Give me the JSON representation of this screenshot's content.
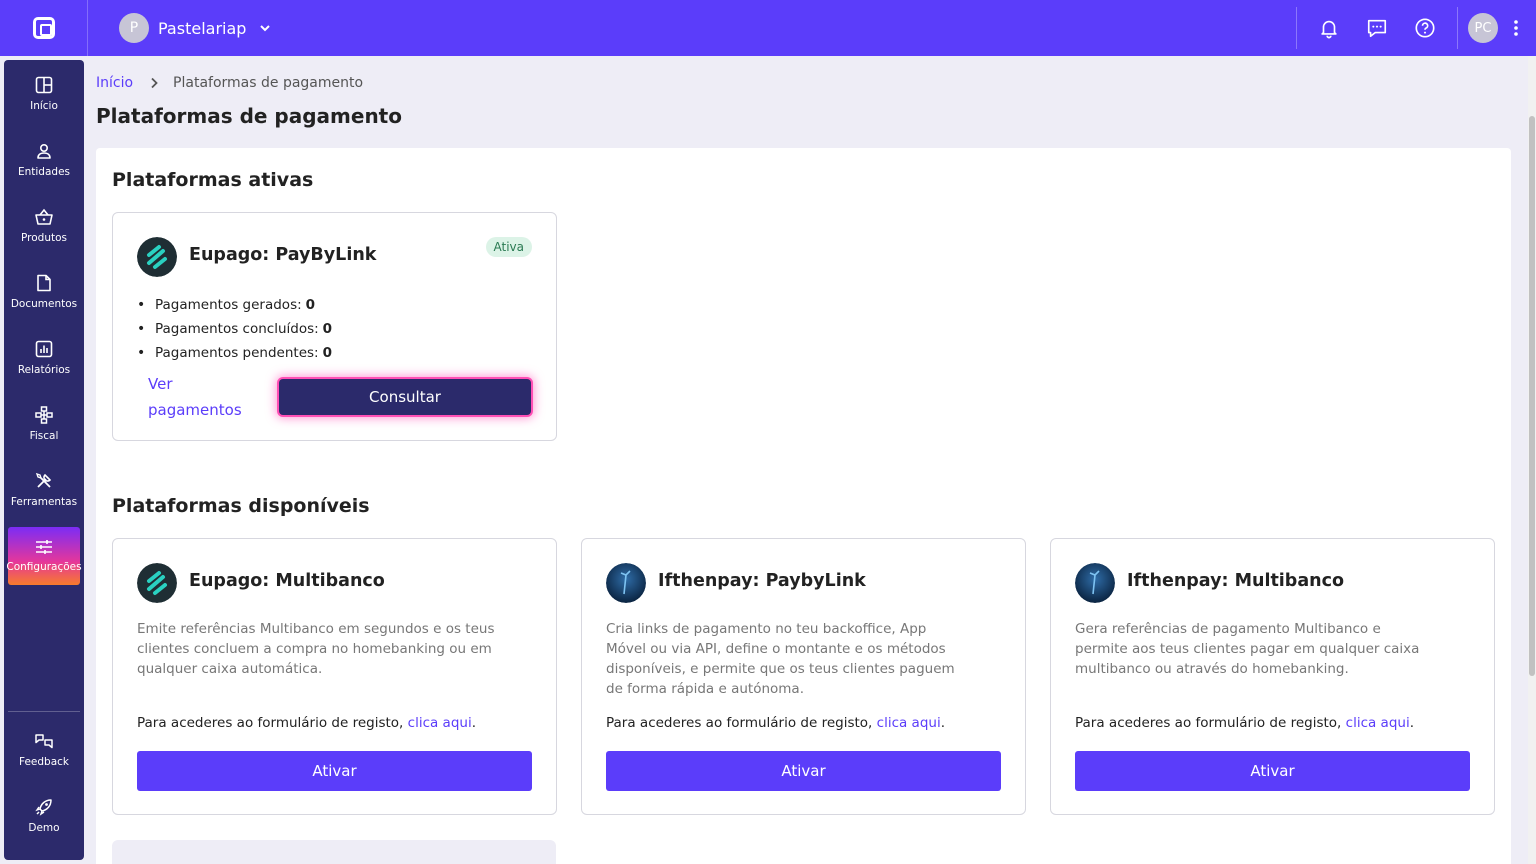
{
  "header": {
    "company_initial": "P",
    "company_name": "Pastelariap",
    "user_initials": "PC"
  },
  "sidebar": {
    "items": [
      {
        "label": "Início",
        "icon": "grid-icon"
      },
      {
        "label": "Entidades",
        "icon": "user-icon"
      },
      {
        "label": "Produtos",
        "icon": "basket-icon"
      },
      {
        "label": "Documentos",
        "icon": "document-icon"
      },
      {
        "label": "Relatórios",
        "icon": "report-icon"
      },
      {
        "label": "Fiscal",
        "icon": "hierarchy-icon"
      },
      {
        "label": "Ferramentas",
        "icon": "tools-icon"
      },
      {
        "label": "Configurações",
        "icon": "sliders-icon"
      }
    ],
    "bottom": [
      {
        "label": "Feedback",
        "icon": "feedback-icon"
      },
      {
        "label": "Demo",
        "icon": "rocket-icon"
      }
    ]
  },
  "breadcrumb": {
    "home": "Início",
    "current": "Plataformas de pagamento"
  },
  "page_title": "Plataformas de pagamento",
  "active_section": {
    "title": "Plataformas ativas",
    "card": {
      "title": "Eupago: PayByLink",
      "badge": "Ativa",
      "stats": [
        {
          "label": "Pagamentos gerados:",
          "value": "0"
        },
        {
          "label": "Pagamentos concluídos:",
          "value": "0"
        },
        {
          "label": "Pagamentos pendentes:",
          "value": "0"
        }
      ],
      "link": "Ver pagamentos",
      "button": "Consultar"
    }
  },
  "available_section": {
    "title": "Plataformas disponíveis",
    "register_prefix": "Para acederes ao formulário de registo, ",
    "register_link": "clica aqui",
    "register_suffix": ".",
    "button": "Ativar",
    "cards": [
      {
        "title": "Eupago: Multibanco",
        "description": "Emite referências Multibanco em segundos e os teus clientes concluem a compra no homebanking ou em qualquer caixa automática."
      },
      {
        "title": "Ifthenpay: PaybyLink",
        "description": "Cria links de pagamento no teu backoffice, App Móvel ou via API, define o montante e os métodos disponíveis, e permite que os teus clientes paguem de forma rápida e autónoma."
      },
      {
        "title": "Ifthenpay: Multibanco",
        "description": "Gera referências de pagamento Multibanco e permite aos teus clientes pagar em qualquer caixa multibanco ou através do homebanking."
      }
    ]
  },
  "colors": {
    "primary": "#5b3dfa",
    "sidebar": "#2c2a6b",
    "consult_button": "#2b2a6b",
    "badge_bg": "#dcf3e7"
  }
}
